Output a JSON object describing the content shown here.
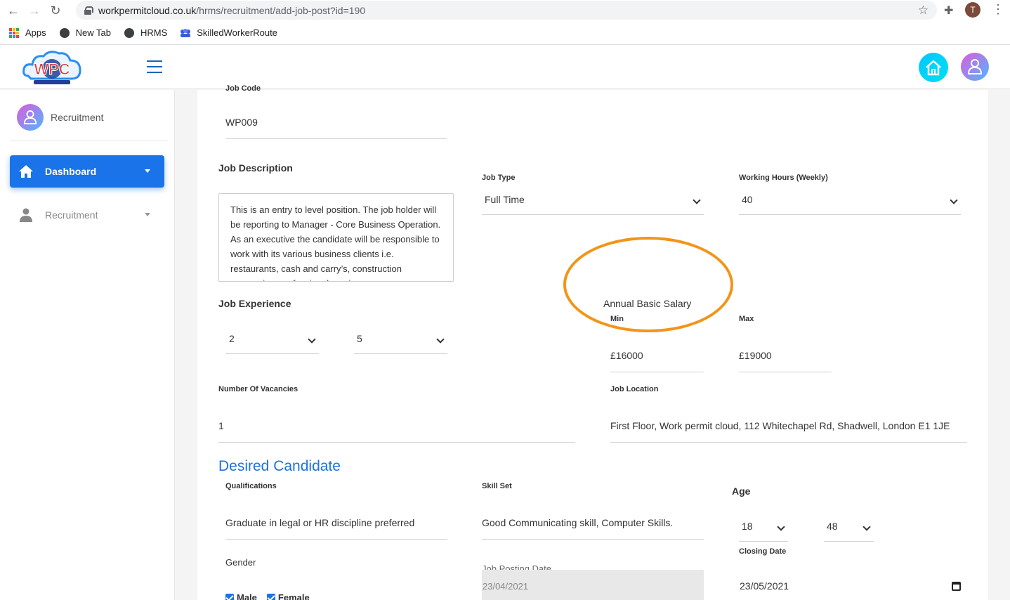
{
  "browser": {
    "url_host": "workpermitcloud.co.uk",
    "url_path": "/hrms/recruitment/add-job-post?id=190",
    "profile_initial": "T",
    "bookmarks": [
      {
        "label": "Apps"
      },
      {
        "label": "New Tab"
      },
      {
        "label": "HRMS"
      },
      {
        "label": "SkilledWorkerRoute"
      }
    ]
  },
  "header": {
    "logo_text": "WPC"
  },
  "sidebar": {
    "user_label": "Recruitment",
    "items": [
      {
        "label": "Dashboard",
        "active": true
      },
      {
        "label": "Recruitment",
        "active": false
      }
    ]
  },
  "form": {
    "job_code": {
      "label": "Job Code",
      "value": "WP009"
    },
    "job_description": {
      "label": "Job Description",
      "value": "This is an entry to level position. The job holder will be reporting to Manager - Core Business Operation. As an executive the candidate will be responsible to work with its various business clients i.e.  restaurants, cash and carry’s, construction companies, professional services"
    },
    "job_type": {
      "label": "Job Type",
      "value": "Full Time"
    },
    "working_hours": {
      "label": "Working Hours (Weekly)",
      "value": "40"
    },
    "job_experience": {
      "label": "Job Experience",
      "min": "2",
      "max": "5"
    },
    "salary": {
      "label": "Annual Basic Salary",
      "min_label": "Min",
      "min": "£16000",
      "max_label": "Max",
      "max": "£19000"
    },
    "vacancies": {
      "label": "Number Of Vacancies",
      "value": "1"
    },
    "job_location": {
      "label": "Job Location",
      "value": "First Floor, Work permit cloud, 112 Whitechapel Rd, Shadwell, London E1 1JE"
    },
    "desired_candidate": {
      "heading": "Desired Candidate"
    },
    "qualifications": {
      "label": "Qualifications",
      "value": "Graduate in legal or HR discipline preferred"
    },
    "skill_set": {
      "label": "Skill Set",
      "value": "Good Communicating skill, Computer Skills."
    },
    "age": {
      "label": "Age",
      "min": "18",
      "max": "48"
    },
    "gender": {
      "label": "Gender",
      "options": [
        {
          "label": "Male",
          "checked": true
        },
        {
          "label": "Female",
          "checked": true
        }
      ]
    },
    "posting_date": {
      "label": "Job Posting Date",
      "value": "23/04/2021"
    },
    "closing_date": {
      "label": "Closing Date",
      "value": "23/05/2021"
    }
  },
  "colors": {
    "accent": "#1a73e8",
    "highlight": "#f39418"
  }
}
